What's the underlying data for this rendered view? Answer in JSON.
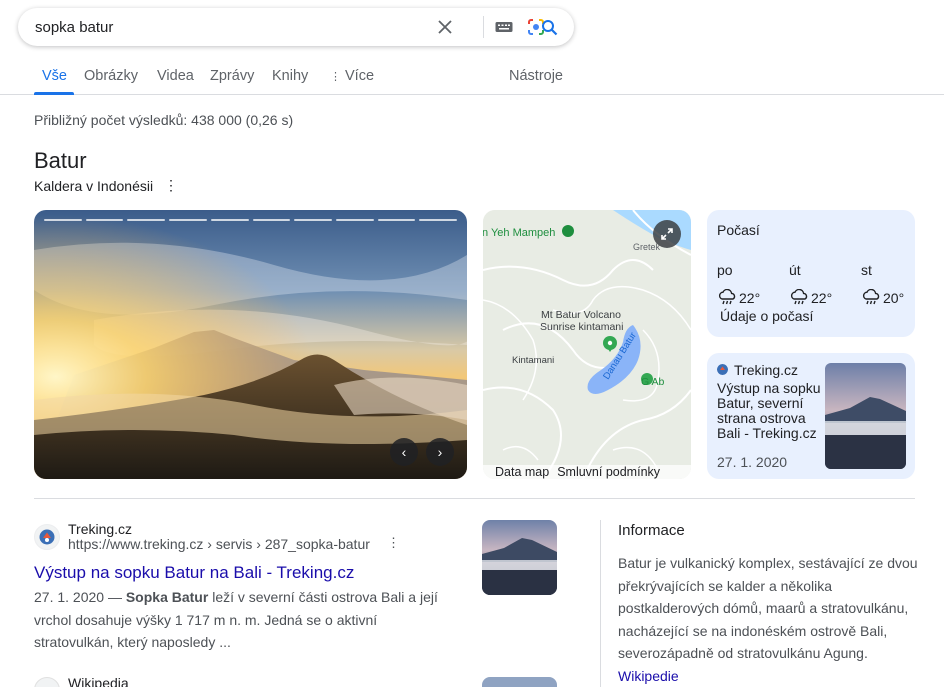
{
  "search": {
    "query": "sopka batur",
    "icons": [
      "close-icon",
      "keyboard-icon",
      "lens-icon",
      "search-icon"
    ]
  },
  "tabs": [
    {
      "label": "Vše",
      "active": true
    },
    {
      "label": "Obrázky"
    },
    {
      "label": "Videa"
    },
    {
      "label": "Zprávy"
    },
    {
      "label": "Knihy"
    },
    {
      "label": "Více"
    }
  ],
  "tools_label": "Nástroje",
  "result_stats": "Přibližný počet výsledků: 438 000 (0,26 s)",
  "knowledge": {
    "title": "Batur",
    "subtitle": "Kaldera v Indonésii"
  },
  "map": {
    "labels": {
      "yeh_mampeh": "n Yeh Mampeh",
      "gretek": "Gretek",
      "volcano": "Mt Batur Volcano",
      "sunrise": "Sunrise kintamani",
      "kintamani": "Kintamani",
      "lake": "Danau Batur",
      "ab": "G Ab"
    },
    "footer": [
      "Data map",
      "Smluvní podmínky"
    ]
  },
  "weather": {
    "title": "Počasí",
    "days": [
      {
        "day": "po",
        "temp": "22°"
      },
      {
        "day": "út",
        "temp": "22°"
      },
      {
        "day": "st",
        "temp": "20°"
      }
    ],
    "link": "Údaje o počasí"
  },
  "article_card": {
    "source": "Treking.cz",
    "title": "Výstup na sopku Batur, severní strana ostrova Bali - Treking.cz",
    "date": "27. 1. 2020"
  },
  "result": {
    "site": "Treking.cz",
    "url": "https://www.treking.cz › servis › 287_sopka-batur",
    "title": "Výstup na sopku Batur na Bali - Treking.cz",
    "date": "27. 1. 2020 —",
    "bold": "Sopka Batur",
    "snippet_rest": " leží v severní části ostrova Bali a její vrchol dosahuje výšky 1 717 m n. m. Jedná se o aktivní stratovulkán, který naposledy ..."
  },
  "result2": {
    "site": "Wikipedia"
  },
  "info": {
    "heading": "Informace",
    "text": "Batur je vulkanický komplex, sestávající ze dvou překrývajících se kalder a několika postkalderových dómů, maarů a stratovulkánu, nacházející se na indonéském ostrově Bali, severozápadně od stratovulkánu Agung.",
    "link": "Wikipedie"
  },
  "colors": {
    "accent": "#1a73e8",
    "link": "#1a0dab",
    "card_bg": "#e8f0fe"
  }
}
